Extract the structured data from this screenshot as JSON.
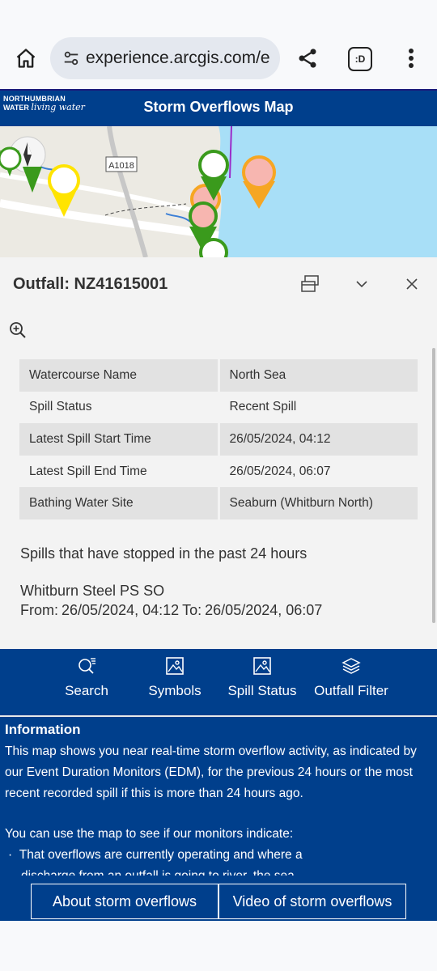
{
  "browser": {
    "url": "experience.arcgis.com/e",
    "tabs_label": ":D"
  },
  "header": {
    "logo_line1": "NORTHUMBRIAN",
    "logo_line2": "WATER",
    "logo_tagline": "living water",
    "title": "Storm Overflows Map"
  },
  "map": {
    "road_label": "A1018",
    "colors": {
      "sea": "#a8dff7",
      "land": "#eceae3",
      "green": "#3a9a1c",
      "yellow": "#ffe400",
      "orange": "#f6a623",
      "pink": "#f7b6b0"
    }
  },
  "popup": {
    "title": "Outfall: NZ41615001",
    "attributes": [
      {
        "key": "Watercourse Name",
        "value": "North Sea"
      },
      {
        "key": "Spill Status",
        "value": "Recent Spill"
      },
      {
        "key": "Latest Spill Start Time",
        "value": "26/05/2024, 04:12"
      },
      {
        "key": "Latest Spill End Time",
        "value": "26/05/2024, 06:07"
      },
      {
        "key": "Bathing Water Site",
        "value": "Seaburn (Whitburn North)"
      }
    ],
    "stopped_heading": "Spills that have stopped in the past 24 hours",
    "site_name": "Whitburn Steel PS SO",
    "from_label": "From:",
    "from_value": "26/05/2024, 04:12",
    "to_label": "To:",
    "to_value": "26/05/2024, 06:07"
  },
  "toolbar": {
    "search": "Search",
    "symbols": "Symbols",
    "spill_status": "Spill Status",
    "outfall_filter": "Outfall Filter"
  },
  "info": {
    "title": "Information",
    "paragraph1": "This map shows you near real-time storm overflow activity, as indicated by our Event Duration Monitors (EDM), for the previous 24 hours or the most recent recorded spill if this is more than 24 hours ago.",
    "paragraph2": "You can use the map to see if our monitors indicate:",
    "bullet1": "That overflows are currently operating and where a",
    "bullet1_cont": "discharge from an outfall is going to river, the sea"
  },
  "footer": {
    "about": "About storm overflows",
    "video": "Video of storm overflows"
  },
  "theme": {
    "brand_blue": "#003f8c",
    "panel_grey": "#f3f3f3"
  }
}
